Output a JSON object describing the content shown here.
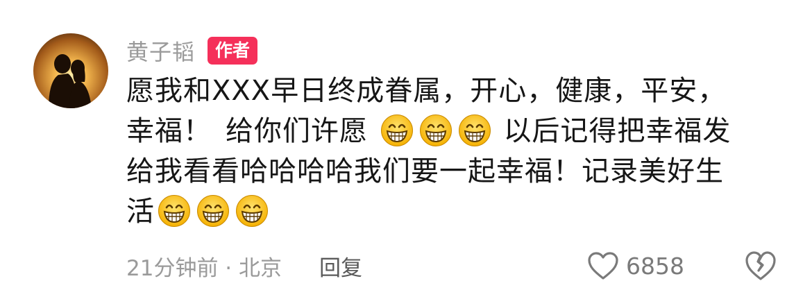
{
  "author": {
    "name": "黄子韬",
    "badge": "作者"
  },
  "comment": {
    "lines": [
      [
        "愿我和XXX早日终成眷属，开心，健康，平安，"
      ],
      [
        "幸福！",
        "给你们许愿",
        "以后记得把幸福发"
      ],
      [
        "给我看看哈哈哈哈我们要一起幸福！记录美好生"
      ],
      [
        "活"
      ]
    ],
    "emoji_name": "grinning-face-icon"
  },
  "footer": {
    "time_location": "21分钟前 · 北京",
    "reply_label": "回复"
  },
  "likes": {
    "count": "6858"
  },
  "colors": {
    "badge": "#f5305a",
    "text": "#161616",
    "meta": "#9a9a9a"
  }
}
